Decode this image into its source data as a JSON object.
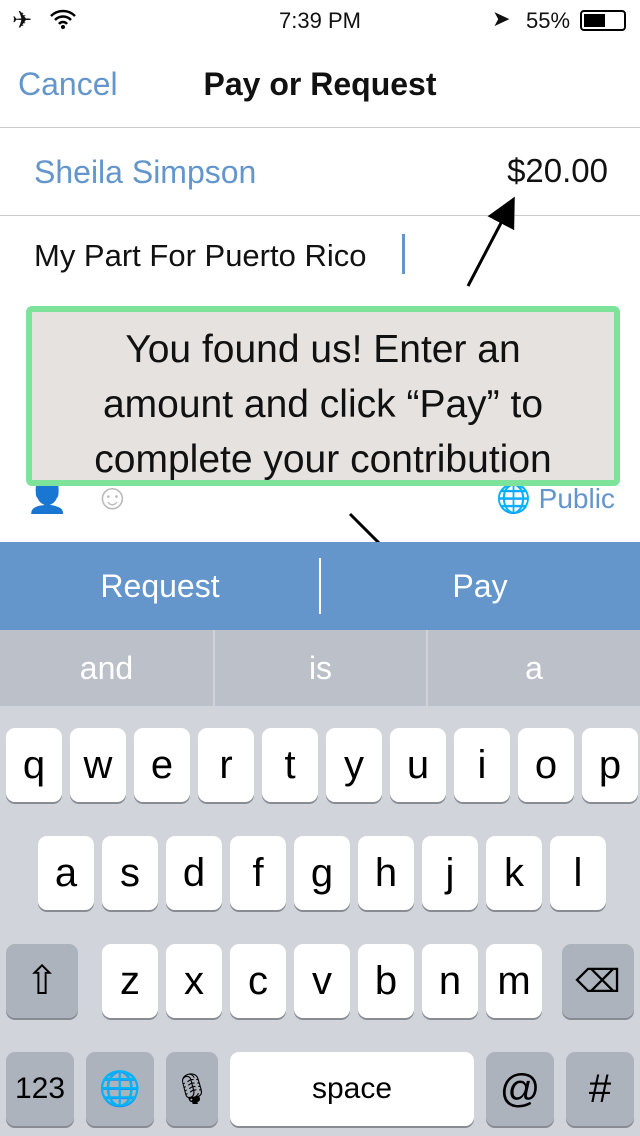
{
  "status": {
    "time": "7:39 PM",
    "battery": "55%",
    "battery_level": 0.55
  },
  "nav": {
    "cancel": "Cancel",
    "title": "Pay or Request"
  },
  "recipient": "Sheila Simpson",
  "amount": "$20.00",
  "note": "My Part For Puerto Rico",
  "privacy": "Public",
  "overlay": {
    "line1": "You found us!  Enter an",
    "line2": "amount and click “Pay” to",
    "line3": "complete your contribution"
  },
  "actions": {
    "request": "Request",
    "pay": "Pay"
  },
  "suggestions": [
    "and",
    "is",
    "a"
  ],
  "keyboard": {
    "row1": [
      "q",
      "w",
      "e",
      "r",
      "t",
      "y",
      "u",
      "i",
      "o",
      "p"
    ],
    "row2": [
      "a",
      "s",
      "d",
      "f",
      "g",
      "h",
      "j",
      "k",
      "l"
    ],
    "row3": [
      "z",
      "x",
      "c",
      "v",
      "b",
      "n",
      "m"
    ],
    "numbers": "123",
    "space": "space",
    "at": "@",
    "hash": "#"
  },
  "colors": {
    "accent": "#6496cc",
    "overlay_border": "#7de39a"
  }
}
